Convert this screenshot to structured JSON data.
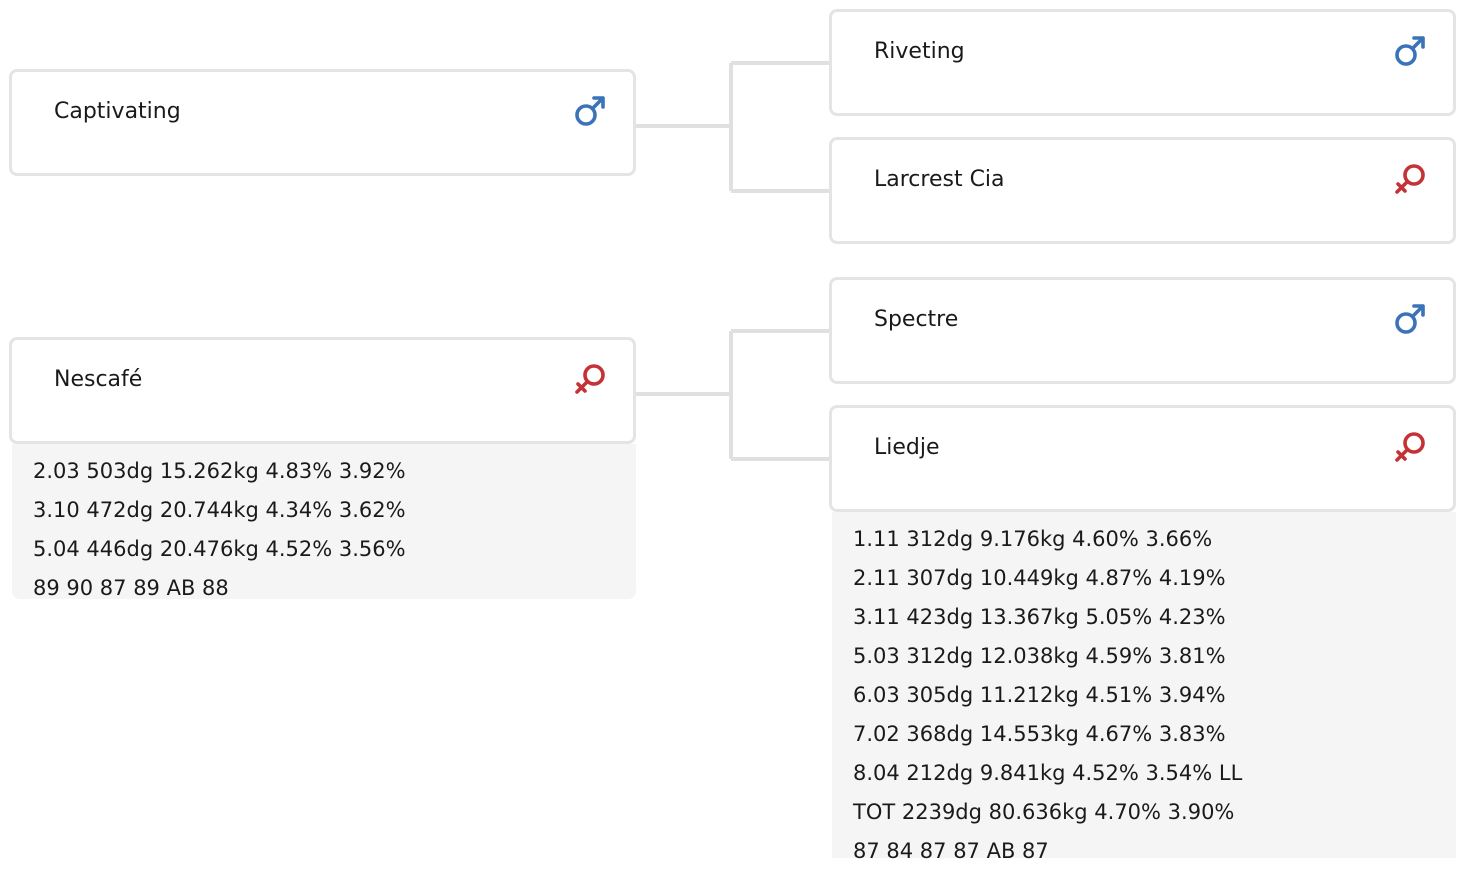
{
  "colors": {
    "male": "#3a73b8",
    "female": "#c43235",
    "card_border": "#e4e4e4",
    "connector": "#e0e0e0",
    "stats_bg": "#f5f5f5"
  },
  "pedigree": {
    "subjects": [
      {
        "name": "Captivating",
        "sex": "male",
        "icon": "male-symbol-icon"
      },
      {
        "name": "Nescafé",
        "sex": "female",
        "icon": "female-symbol-icon",
        "stats": [
          "2.03 503dg 15.262kg 4.83% 3.92%",
          "3.10 472dg 20.744kg 4.34% 3.62%",
          "5.04 446dg 20.476kg 4.52% 3.56%",
          "89 90 87 89 AB 88"
        ]
      }
    ],
    "parents": [
      {
        "name": "Riveting",
        "sex": "male",
        "icon": "male-symbol-icon"
      },
      {
        "name": "Larcrest Cia",
        "sex": "female",
        "icon": "female-symbol-icon"
      },
      {
        "name": "Spectre",
        "sex": "male",
        "icon": "male-symbol-icon"
      },
      {
        "name": "Liedje",
        "sex": "female",
        "icon": "female-symbol-icon",
        "stats": [
          "1.11 312dg 9.176kg 4.60% 3.66%",
          "2.11 307dg 10.449kg 4.87% 4.19%",
          "3.11 423dg 13.367kg 5.05% 4.23%",
          "5.03 312dg 12.038kg 4.59% 3.81%",
          "6.03 305dg 11.212kg 4.51% 3.94%",
          "7.02 368dg 14.553kg 4.67% 3.83%",
          "8.04 212dg 9.841kg 4.52% 3.54% LL",
          "TOT 2239dg 80.636kg 4.70% 3.90%",
          "87 84 87 87 AB 87"
        ]
      }
    ]
  }
}
